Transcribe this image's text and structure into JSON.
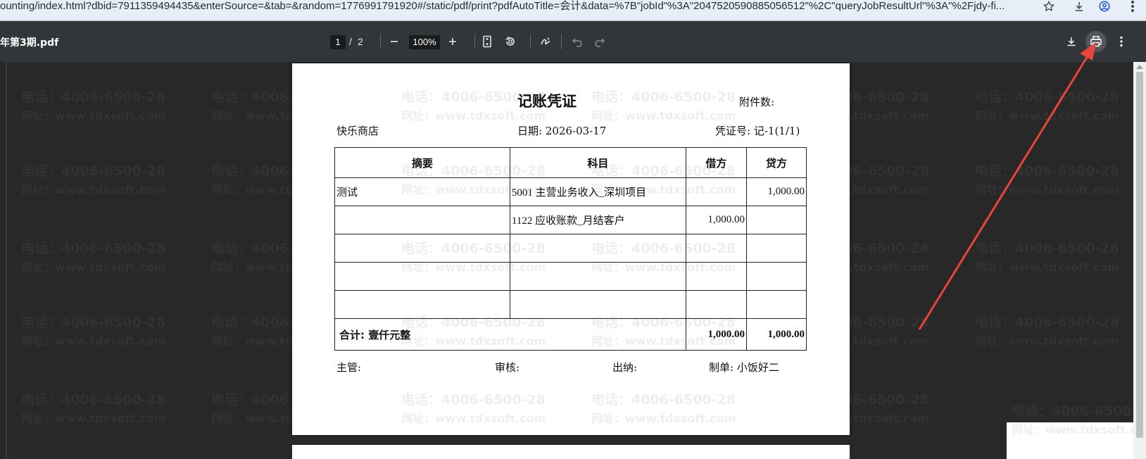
{
  "browser": {
    "url": "ounting/index.html?dbid=7911359494435&enterSource=&tab=&random=1776991791920#/static/pdf/print?pdfAutoTitle=会计&data=%7B\"jobId\"%3A\"2047520590885056512\"%2C\"queryJobResultUrl\"%3A\"%2Fjdy-fi..."
  },
  "toolbar": {
    "title": "年第3期.pdf",
    "page_current": "1",
    "page_separator": "/",
    "page_total": "2",
    "zoom": "100%"
  },
  "watermark": {
    "line1": "电话：4006-6500-28",
    "line2": "网址：www.tdxsoft.com"
  },
  "voucher": {
    "title": "记账凭证",
    "attachments_label": "附件数:",
    "company": "快乐商店",
    "date_label": "日期:",
    "date": "2026-03-17",
    "voucher_no_label": "凭证号:",
    "voucher_no": "记-1(1/1)",
    "headers": [
      "摘要",
      "科目",
      "借方",
      "贷方"
    ],
    "rows": [
      {
        "summary": "测试",
        "account": "5001 主营业务收入_深圳项目",
        "debit": "",
        "credit": "1,000.00"
      },
      {
        "summary": "",
        "account": "1122 应收账款_月结客户",
        "debit": "1,000.00",
        "credit": ""
      },
      {
        "summary": "",
        "account": "",
        "debit": "",
        "credit": ""
      },
      {
        "summary": "",
        "account": "",
        "debit": "",
        "credit": ""
      },
      {
        "summary": "",
        "account": "",
        "debit": "",
        "credit": ""
      }
    ],
    "total_label": "合计: 壹仟元整",
    "total_debit": "1,000.00",
    "total_credit": "1,000.00",
    "supervisor_label": "主管:",
    "auditor_label": "审核:",
    "cashier_label": "出纳:",
    "preparer_label": "制单:",
    "preparer": "小饭好二"
  },
  "colors": {
    "toolbar_bg": "#323639",
    "viewer_bg": "#282828",
    "annotation_arrow": "#e8453c"
  }
}
